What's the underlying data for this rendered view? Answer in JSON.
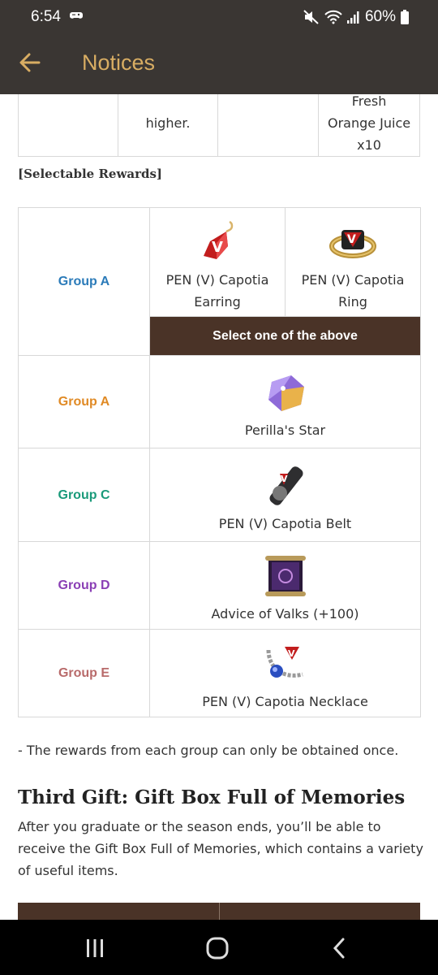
{
  "status_bar": {
    "time": "6:54",
    "battery": "60%",
    "left_icon": "game-controller-icon",
    "icons": [
      "mute-icon",
      "wifi-icon",
      "signal-icon",
      "battery-icon"
    ]
  },
  "app_bar": {
    "title": "Notices",
    "back_icon": "back-arrow-icon",
    "title_color": "#d8ad63",
    "background": "#3a3633"
  },
  "top_table": {
    "cells": [
      "",
      "higher.",
      "",
      "Fresh Orange Juice x10"
    ]
  },
  "section_label": "[Selectable Rewards]",
  "rewards": {
    "groups": [
      {
        "label": "Group A",
        "color": "#2b7bb9",
        "items": [
          {
            "name": "PEN (V) Capotia Earring",
            "icon": "earring-icon"
          },
          {
            "name": "PEN (V) Capotia Ring",
            "icon": "ring-icon"
          }
        ],
        "select_text": "Select one of the above"
      },
      {
        "label": "Group A",
        "color": "#e08a25",
        "items": [
          {
            "name": "Perilla's Star",
            "icon": "star-gem-icon"
          }
        ]
      },
      {
        "label": "Group C",
        "color": "#1a9a7a",
        "items": [
          {
            "name": "PEN (V) Capotia Belt",
            "icon": "belt-icon"
          }
        ]
      },
      {
        "label": "Group D",
        "color": "#8a3fb5",
        "items": [
          {
            "name": "Advice of Valks (+100)",
            "icon": "scroll-icon"
          }
        ]
      },
      {
        "label": "Group E",
        "color": "#b86a6a",
        "items": [
          {
            "name": "PEN (V) Capotia Necklace",
            "icon": "necklace-icon"
          }
        ]
      }
    ]
  },
  "note": "- The rewards from each group can only be obtained once.",
  "gift": {
    "heading": "Third Gift: Gift Box Full of Memories",
    "description": "After you graduate or the season ends, you’ll be able to receive the Gift Box Full of Memories, which contains a variety of useful items."
  },
  "nav_bar": {
    "recent_icon": "recent-apps-icon",
    "home_icon": "home-icon",
    "back_icon": "nav-back-icon"
  }
}
